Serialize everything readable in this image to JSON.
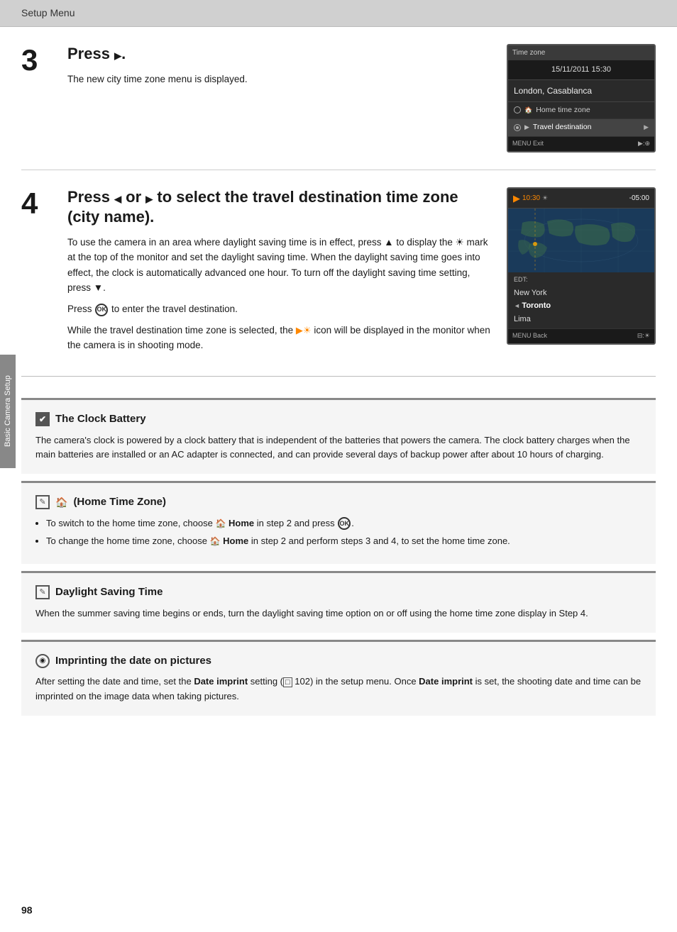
{
  "header": {
    "title": "Setup Menu"
  },
  "sidebar": {
    "label": "Basic Camera Setup"
  },
  "page_number": "98",
  "step3": {
    "number": "3",
    "title_parts": [
      "Press ",
      "▶",
      "."
    ],
    "description": "The new city time zone menu is displayed.",
    "screen": {
      "title": "Time zone",
      "time": "15/11/2011 15:30",
      "city": "London, Casablanca",
      "menu_items": [
        {
          "label": "Home time zone",
          "selected": false
        },
        {
          "label": "Travel destination",
          "selected": true
        }
      ],
      "footer_left": "MENU Exit",
      "footer_right": "▶:⊕"
    }
  },
  "step4": {
    "number": "4",
    "title": "Press ◀ or ▶ to select the travel destination time zone (city name).",
    "para1": "To use the camera in an area where daylight saving time is in effect, press ▲ to display the",
    "para1b": "mark at the top of the monitor and set the daylight saving time. When the daylight saving time goes into effect, the clock is automatically advanced one hour. To turn off the daylight saving time setting, press ▼.",
    "para2": "Press",
    "para2b": "to enter the travel destination.",
    "para3": "While the travel destination time zone is selected, the",
    "para3b": "icon will be displayed in the monitor when the camera is in shooting mode.",
    "screen": {
      "header_left_arrow": "▶",
      "header_time": "10:30",
      "header_offset": "-05:00",
      "label": "EDT:",
      "cities": [
        "New York",
        "Toronto",
        "Lima"
      ],
      "selected_city": "Toronto",
      "footer_left": "MENU Back",
      "footer_right": "⊟:☀"
    }
  },
  "notes": {
    "clock_battery": {
      "icon": "✔",
      "title": "The Clock Battery",
      "body": "The camera's clock is powered by a clock battery that is independent of the batteries that powers the camera. The clock battery charges when the main batteries are installed or an AC adapter is connected, and can provide several days of backup power after about 10 hours of charging."
    },
    "home_time_zone": {
      "icon": "✎",
      "title": "(Home Time Zone)",
      "bullets": [
        {
          "text_before": "To switch to the home time zone, choose ",
          "bold": "Home",
          "text_mid": " in step 2 and press ",
          "ok": "OK",
          "text_after": "."
        },
        {
          "text_before": "To change the home time zone, choose ",
          "bold": "Home",
          "text_mid": " in step 2 and perform steps 3 and 4, to set the home time zone.",
          "ok": ""
        }
      ]
    },
    "daylight_saving": {
      "icon": "✎",
      "title": "Daylight Saving Time",
      "body": "When the summer saving time begins or ends, turn the daylight saving time option on or off using the home time zone display in Step 4."
    },
    "date_imprint": {
      "icon": "◉",
      "title": "Imprinting the date on pictures",
      "body_before": "After setting the date and time, set the ",
      "bold1": "Date imprint",
      "body_mid": " setting (",
      "page_ref": "□ 102",
      "body_mid2": ") in the setup menu. Once ",
      "bold2": "Date imprint",
      "body_after": " is set, the shooting date and time can be imprinted on the image data when taking pictures."
    }
  }
}
